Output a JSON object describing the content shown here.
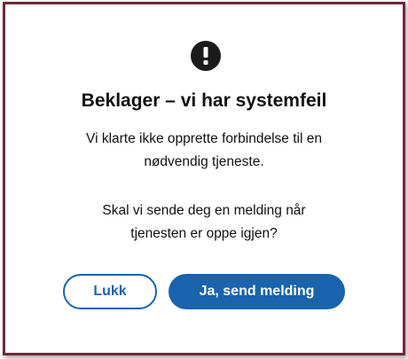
{
  "dialog": {
    "icon": "exclamation-icon",
    "title": "Beklager – vi har systemfeil",
    "message_lines": [
      "Vi klarte ikke opprette forbindelse til en",
      "nødvendig tjeneste."
    ],
    "question_lines": [
      "Skal vi sende deg en melding når",
      "tjenesten er oppe igjen?"
    ],
    "buttons": {
      "close_label": "Lukk",
      "send_label": "Ja, send melding"
    }
  },
  "colors": {
    "frame_border": "#6e2a3c",
    "primary": "#1a63ad",
    "icon_bg": "#1b1b1b",
    "text": "#111111"
  }
}
